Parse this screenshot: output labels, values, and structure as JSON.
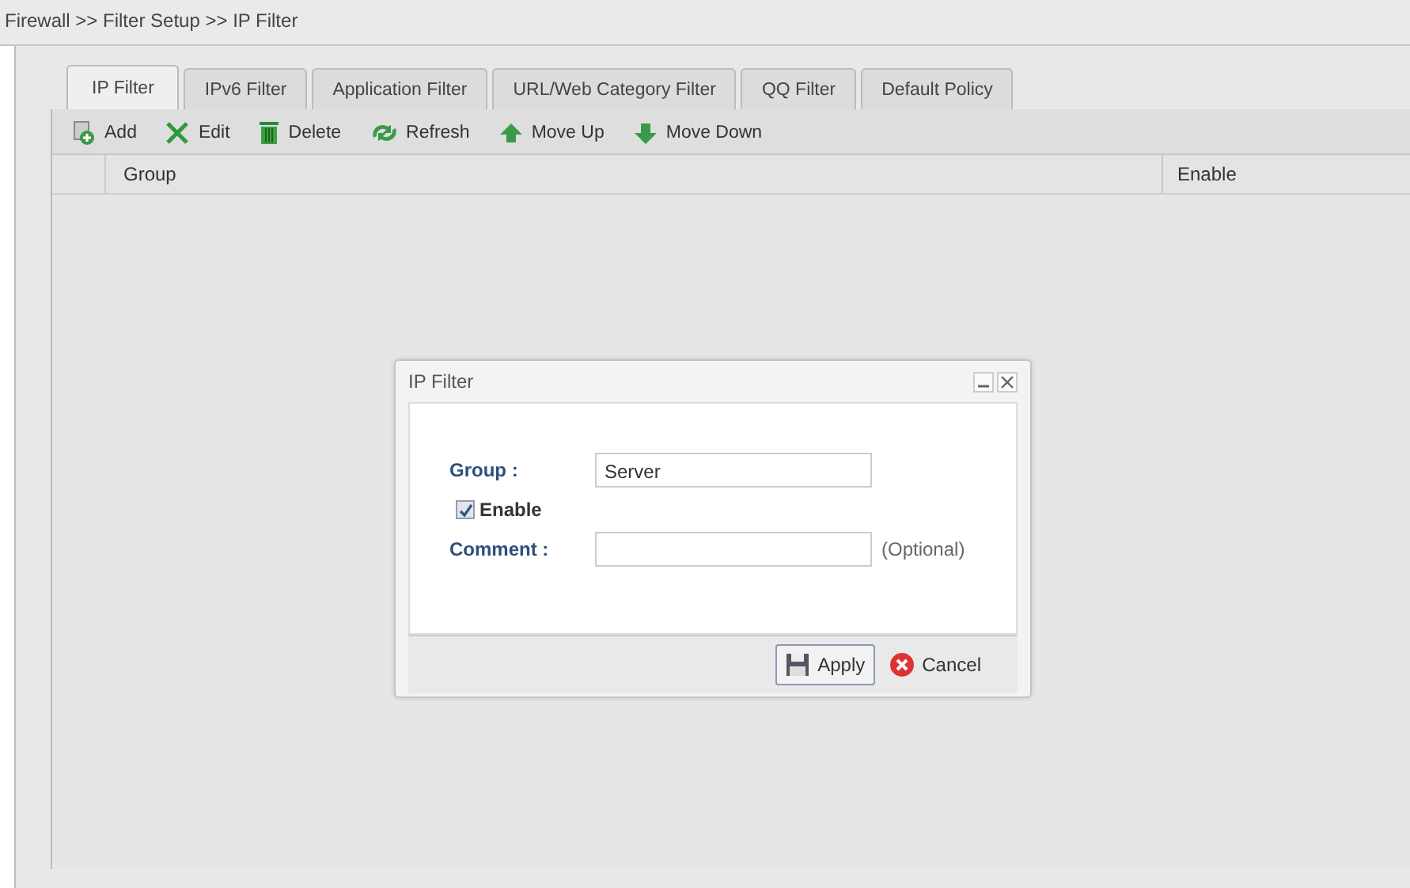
{
  "breadcrumb": "Firewall >> Filter Setup >> IP Filter",
  "tabs": [
    {
      "label": "IP Filter",
      "selected": true
    },
    {
      "label": "IPv6 Filter",
      "selected": false
    },
    {
      "label": "Application Filter",
      "selected": false
    },
    {
      "label": "URL/Web Category Filter",
      "selected": false
    },
    {
      "label": "QQ Filter",
      "selected": false
    },
    {
      "label": "Default Policy",
      "selected": false
    }
  ],
  "toolbar": [
    {
      "kind": "add",
      "label": "Add"
    },
    {
      "kind": "edit",
      "label": "Edit"
    },
    {
      "kind": "delete",
      "label": "Delete"
    },
    {
      "kind": "refresh",
      "label": "Refresh"
    },
    {
      "kind": "up",
      "label": "Move Up"
    },
    {
      "kind": "down",
      "label": "Move Down"
    }
  ],
  "table": {
    "columns": [
      "Group",
      "Enable"
    ]
  },
  "dialog": {
    "title": "IP Filter",
    "group_label": "Group :",
    "group_value": "Server",
    "enable_label": "Enable",
    "enable_checked": true,
    "comment_label": "Comment :",
    "comment_hint": "(Optional)",
    "buttons": [
      {
        "kind": "apply",
        "label": "Apply"
      },
      {
        "kind": "cancel",
        "label": "Cancel"
      }
    ]
  }
}
